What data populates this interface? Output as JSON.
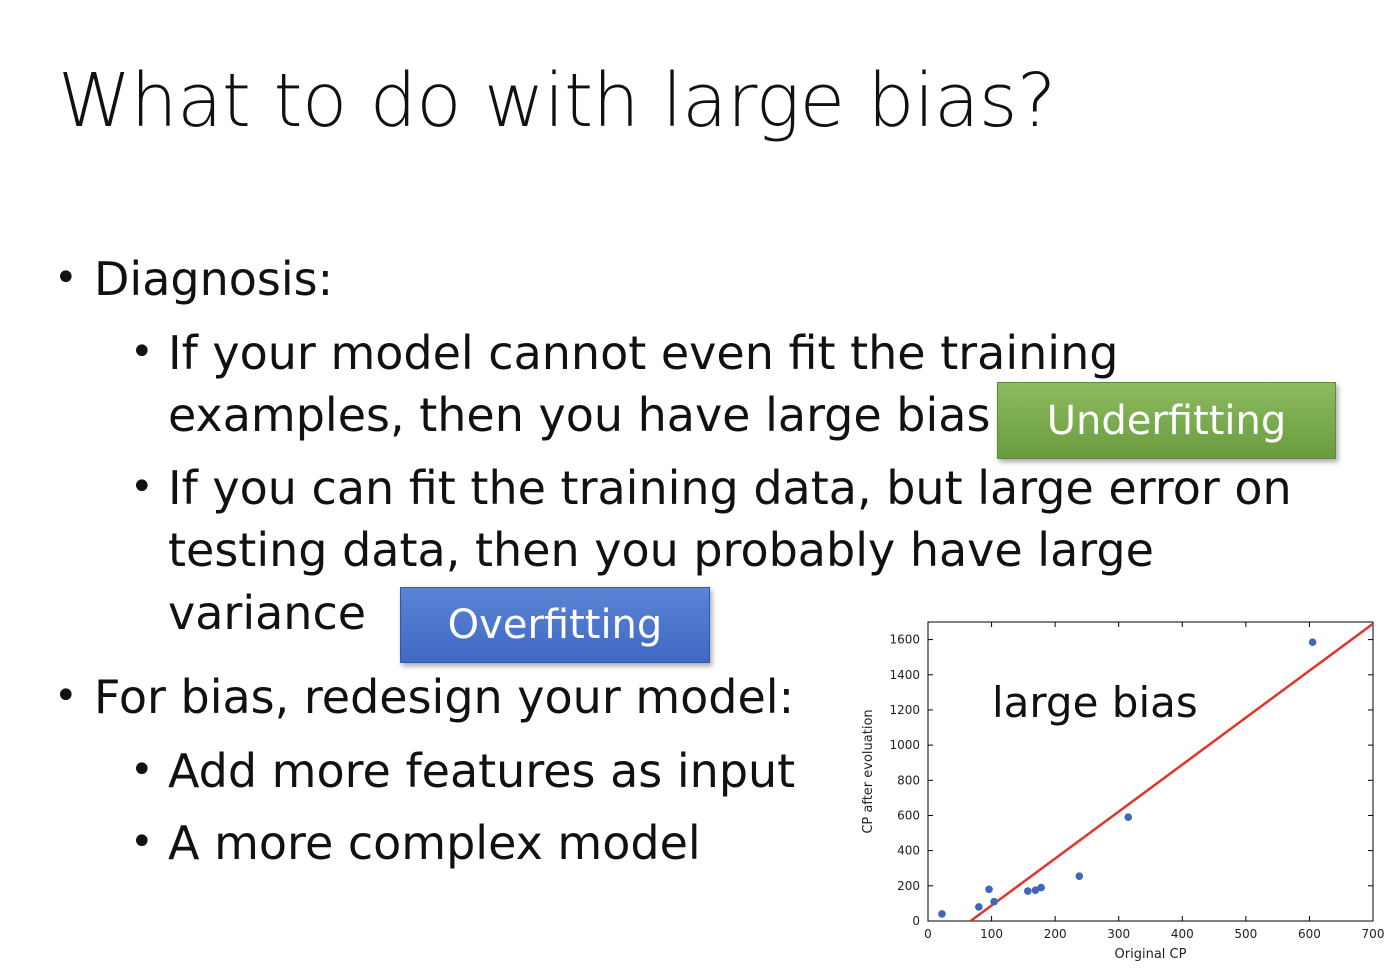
{
  "slide": {
    "title": "What to do with large bias?",
    "bullets": {
      "diagnosis": "Diagnosis:",
      "fit_line1": "If your model cannot even fit the training",
      "fit_line2": "examples, then you have large bias",
      "test_line1": "If you can fit the training data, but large error on",
      "test_line2": "testing data, then you probably have large",
      "test_line3": "variance",
      "redesign": "For bias, redesign your model:",
      "features": "Add more features as input",
      "complex": "A more complex model"
    },
    "bullet_glyph": "•",
    "tags": {
      "underfitting": "Underfitting",
      "overfitting": "Overfitting"
    },
    "chart_note": "large bias"
  },
  "colors": {
    "underfitting_tag": "#76a84a",
    "overfitting_tag": "#4472c4",
    "scatter_points": "#3f66b9",
    "fit_line": "#e0352b"
  },
  "chart_data": {
    "type": "scatter",
    "title": "",
    "xlabel": "Original CP",
    "ylabel": "CP after evoluation",
    "xlim": [
      0,
      700
    ],
    "ylim": [
      0,
      1700
    ],
    "x_ticks": [
      0,
      100,
      200,
      300,
      400,
      500,
      600,
      700
    ],
    "y_ticks": [
      0,
      200,
      400,
      600,
      800,
      1000,
      1200,
      1400,
      1600
    ],
    "grid": false,
    "points": [
      {
        "x": 22,
        "y": 40
      },
      {
        "x": 80,
        "y": 80
      },
      {
        "x": 96,
        "y": 180
      },
      {
        "x": 104,
        "y": 110
      },
      {
        "x": 157,
        "y": 170
      },
      {
        "x": 169,
        "y": 175
      },
      {
        "x": 178,
        "y": 190
      },
      {
        "x": 238,
        "y": 255
      },
      {
        "x": 315,
        "y": 590
      },
      {
        "x": 605,
        "y": 1585
      }
    ],
    "fit_line": {
      "x": [
        67,
        700
      ],
      "y": [
        0,
        1690
      ]
    }
  }
}
